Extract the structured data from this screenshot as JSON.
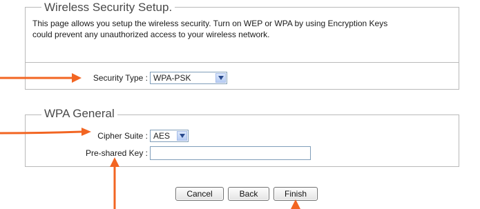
{
  "security_setup": {
    "legend": "Wireless Security Setup.",
    "description_line1": "This page allows you setup the wireless security. Turn on WEP or WPA by using Encryption Keys",
    "description_line2": "could prevent any unauthorized access to your wireless network.",
    "security_type_label": "Security Type :",
    "security_type_value": "WPA-PSK"
  },
  "wpa_general": {
    "legend": "WPA General",
    "cipher_suite_label": "Cipher Suite :",
    "cipher_suite_value": "AES",
    "preshared_key_label": "Pre-shared Key :",
    "preshared_key_value": ""
  },
  "buttons": {
    "cancel": "Cancel",
    "back": "Back",
    "finish": "Finish"
  },
  "colors": {
    "annotation_arrow": "#f26522"
  }
}
